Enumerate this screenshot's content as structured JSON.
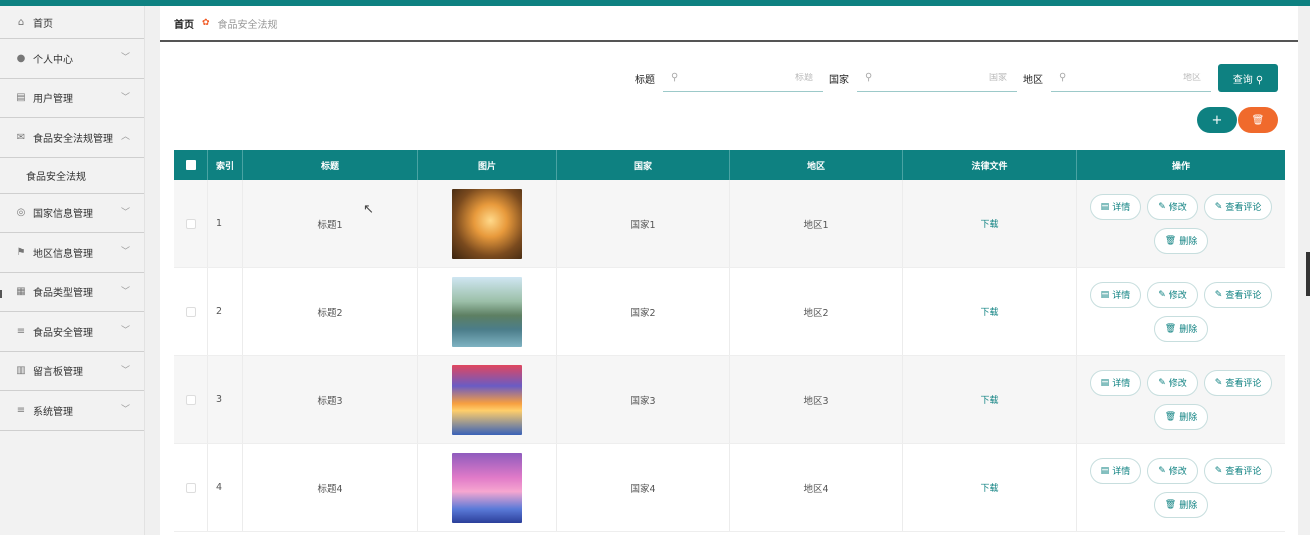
{
  "sidebar": {
    "items": [
      {
        "label": "首页",
        "icon": "home-icon",
        "glyph": "⌂"
      },
      {
        "label": "个人中心",
        "icon": "user-icon",
        "glyph": "●",
        "chevron": "﹀"
      },
      {
        "label": "用户管理",
        "icon": "list-icon",
        "glyph": "▤",
        "chevron": "﹀"
      },
      {
        "label": "食品安全法规管理",
        "icon": "mail-icon",
        "glyph": "✉",
        "chevron": "︿",
        "sub": "食品安全法规"
      },
      {
        "label": "国家信息管理",
        "icon": "compass-icon",
        "glyph": "◎",
        "chevron": "﹀"
      },
      {
        "label": "地区信息管理",
        "icon": "flag-icon",
        "glyph": "⚑",
        "chevron": "﹀"
      },
      {
        "label": "食品类型管理",
        "icon": "bank-icon",
        "glyph": "▦",
        "chevron": "﹀"
      },
      {
        "label": "食品安全管理",
        "icon": "menu-icon",
        "glyph": "≡",
        "chevron": "﹀"
      },
      {
        "label": "留言板管理",
        "icon": "bar-chart-icon",
        "glyph": "▥",
        "chevron": "﹀"
      },
      {
        "label": "系统管理",
        "icon": "menu-icon",
        "glyph": "≡",
        "chevron": "﹀"
      }
    ]
  },
  "breadcrumb": {
    "home": "首页",
    "separator": "✿",
    "current": "食品安全法规"
  },
  "search": {
    "title_label": "标题",
    "title_placeholder": "标题",
    "country_label": "国家",
    "country_placeholder": "国家",
    "region_label": "地区",
    "region_placeholder": "地区",
    "query_label": "查询 ⚲",
    "search_glyph": "⚲"
  },
  "actions": {
    "add_glyph": "+",
    "delete_glyph": "🗑"
  },
  "table": {
    "headers": {
      "index": "索引",
      "title": "标题",
      "image": "图片",
      "country": "国家",
      "region": "地区",
      "law_file": "法律文件",
      "ops": "操作"
    },
    "rows": [
      {
        "index": "1",
        "title": "标题1",
        "country": "国家1",
        "region": "地区1",
        "law_file": "下载",
        "image": "sunset-tree"
      },
      {
        "index": "2",
        "title": "标题2",
        "country": "国家2",
        "region": "地区2",
        "law_file": "下载",
        "image": "mountain-bridge"
      },
      {
        "index": "3",
        "title": "标题3",
        "country": "国家3",
        "region": "地区3",
        "law_file": "下载",
        "image": "dolphin-sunset"
      },
      {
        "index": "4",
        "title": "标题4",
        "country": "国家4",
        "region": "地区4",
        "law_file": "下载",
        "image": "palm-beach"
      }
    ],
    "ops": {
      "detail": "详情",
      "edit": "修改",
      "view_comments": "查看评论",
      "delete": "删除"
    }
  },
  "colors": {
    "accent": "#0e8181",
    "danger": "#f06a2c"
  }
}
